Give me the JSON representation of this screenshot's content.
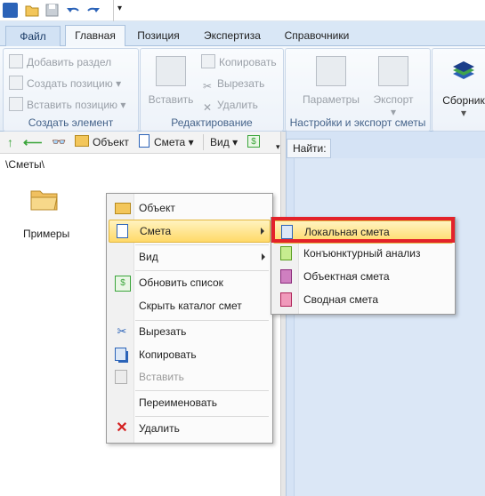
{
  "quick_access": {
    "customize_glyph": "▾"
  },
  "tabs": [
    {
      "label": "Файл"
    },
    {
      "label": "Главная"
    },
    {
      "label": "Позиция"
    },
    {
      "label": "Экспертиза"
    },
    {
      "label": "Справочники"
    }
  ],
  "ribbon": {
    "create_group": {
      "label": "Создать элемент",
      "add_section": "Добавить раздел",
      "create_position": "Создать позицию",
      "insert_position": "Вставить позицию"
    },
    "edit_group": {
      "label": "Редактирование",
      "paste": "Вставить",
      "copy": "Копировать",
      "cut": "Вырезать",
      "delete": "Удалить"
    },
    "settings_group": {
      "label": "Настройки и экспорт сметы",
      "params": "Параметры",
      "export": "Экспорт"
    },
    "collection": {
      "label": "Сборник"
    }
  },
  "left_toolbar": {
    "object": "Объект",
    "estimate": "Смета",
    "view": "Вид"
  },
  "path": "\\Сметы\\",
  "find_label": "Найти:",
  "folder": {
    "label": "Примеры"
  },
  "context_menu": {
    "object": "Объект",
    "estimate": "Смета",
    "view": "Вид",
    "refresh": "Обновить список",
    "hide_catalog": "Скрыть каталог смет",
    "cut": "Вырезать",
    "copy": "Копировать",
    "paste": "Вставить",
    "rename": "Переименовать",
    "delete": "Удалить"
  },
  "submenu": {
    "local": "Локальная смета",
    "market": "Конъюнктурный анализ",
    "object": "Объектная смета",
    "summary": "Сводная смета"
  },
  "colors": {
    "highlight": "#e3222a",
    "accent": "#2b63b8"
  }
}
